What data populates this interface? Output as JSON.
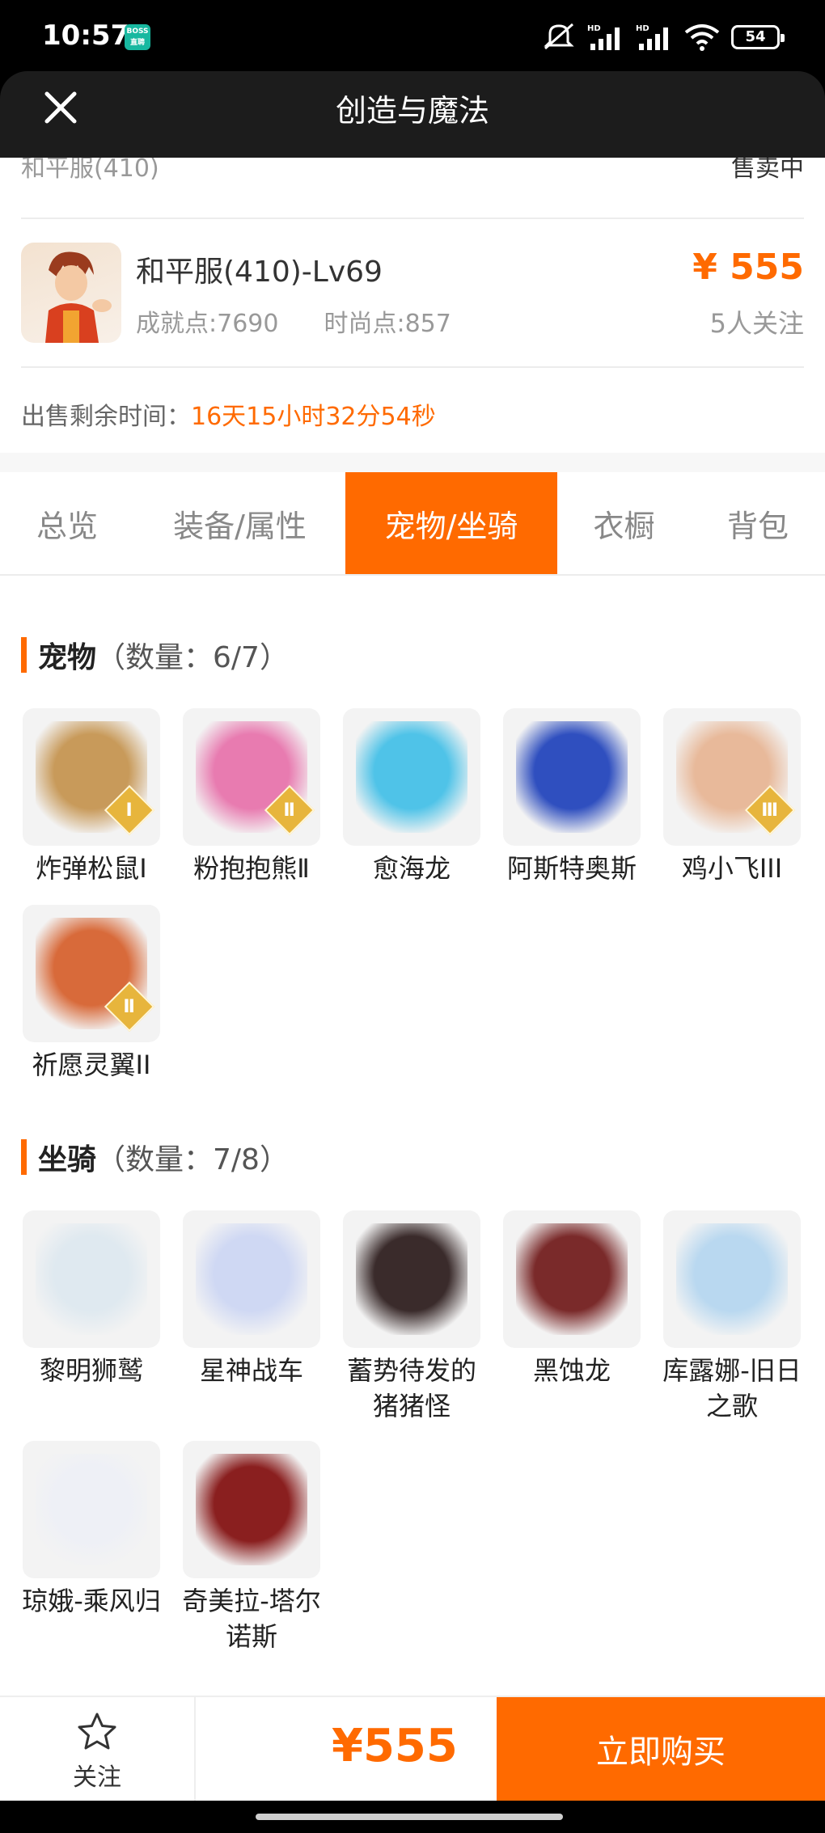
{
  "status_bar": {
    "time": "10:57",
    "app_badge": "BOSS 直聘",
    "battery": "54",
    "icons": [
      "mute-icon",
      "hd-signal-icon",
      "hd-signal-icon",
      "wifi-icon",
      "battery-icon"
    ]
  },
  "header": {
    "title": "创造与魔法",
    "close_icon": "close-icon"
  },
  "listing": {
    "cut_left": "和平服(410)",
    "cut_right": "售卖中",
    "server_name": "和平服(410)-Lv69",
    "achievement": "成就点:7690",
    "fashion": "时尚点:857",
    "price": "¥ 555",
    "watchers": "5人关注",
    "remain_label": "出售剩余时间：",
    "remain_value": "16天15小时32分54秒"
  },
  "tabs": [
    {
      "label": "总览",
      "active": false
    },
    {
      "label": "装备/属性",
      "active": false
    },
    {
      "label": "宠物/坐骑",
      "active": true
    },
    {
      "label": "衣橱",
      "active": false
    },
    {
      "label": "背包",
      "active": false
    }
  ],
  "pets": {
    "title": "宠物",
    "count": "（数量：6/7）",
    "items": [
      {
        "name": "炸弹松鼠Ⅰ",
        "grade": "Ⅰ",
        "color": "#c89a5a"
      },
      {
        "name": "粉抱抱熊Ⅱ",
        "grade": "Ⅱ",
        "color": "#e87bb0"
      },
      {
        "name": "愈海龙",
        "grade": "",
        "color": "#4fc3e8"
      },
      {
        "name": "阿斯特奥斯",
        "grade": "",
        "color": "#2f4fbf"
      },
      {
        "name": "鸡小飞III",
        "grade": "Ⅲ",
        "color": "#e8b99a"
      },
      {
        "name": "祈愿灵翼II",
        "grade": "Ⅱ",
        "color": "#d86a3a"
      }
    ]
  },
  "mounts": {
    "title": "坐骑",
    "count": "（数量：7/8）",
    "items": [
      {
        "name": "黎明狮鹫",
        "color": "#dfe9f0"
      },
      {
        "name": "星神战车",
        "color": "#cfd8f3"
      },
      {
        "name": "蓄势待发的猪猪怪",
        "color": "#3a2b2b"
      },
      {
        "name": "黑蚀龙",
        "color": "#7a2a2a"
      },
      {
        "name": "库露娜-旧日之歌",
        "color": "#b9d8f0"
      },
      {
        "name": "琼娥-乘风归",
        "color": "#eef0f6"
      },
      {
        "name": "奇美拉-塔尔诺斯",
        "color": "#8a1f1f"
      }
    ]
  },
  "bottom_bar": {
    "follow_label": "关注",
    "price": "¥555",
    "buy_label": "立即购买"
  }
}
